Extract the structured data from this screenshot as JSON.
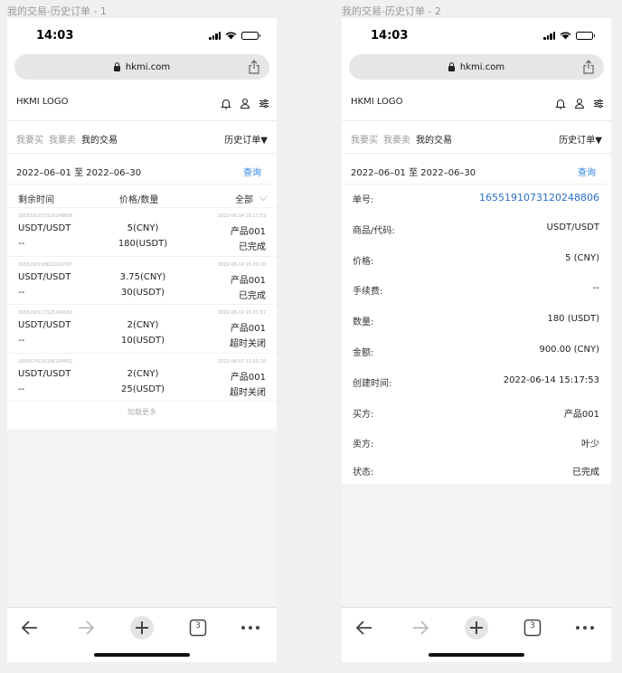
{
  "frames": [
    {
      "label": "我的交易-历史订单 - 1",
      "status": {
        "time": "14:03"
      },
      "browser": {
        "url": "hkmi.com",
        "tab_count": "3"
      },
      "header": {
        "logo": "HKMI LOGO"
      },
      "tabs": [
        "我要买",
        "我要卖",
        "我的交易"
      ],
      "filter": "历史订单▼",
      "date_range": "2022–06–01 至 2022–06–30",
      "query_label": "查询",
      "columns": {
        "remaining": "剩余时间",
        "price_qty": "价格/数量",
        "all": "全部"
      },
      "orders": [
        {
          "id": "1655191073120248806",
          "time": "2022-06-14 15:17:53",
          "pair": "USDT/USDT",
          "remaining": "--",
          "price": "5(CNY)",
          "qty": "180(USDT)",
          "product": "产品001",
          "status": "已完成"
        },
        {
          "id": "1655190190622241787",
          "time": "2022-06-14 15:03:10",
          "pair": "USDT/USDT",
          "remaining": "--",
          "price": "3.75(CNY)",
          "qty": "30(USDT)",
          "product": "产品001",
          "status": "已完成"
        },
        {
          "id": "1655190117125246562",
          "time": "2022-06-14 15:01:57",
          "pair": "USDT/USDT",
          "remaining": "--",
          "price": "2(CNY)",
          "qty": "10(USDT)",
          "product": "产品001",
          "status": "超时关闭"
        },
        {
          "id": "1654574116166244852",
          "time": "2022-06-07 11:55:16",
          "pair": "USDT/USDT",
          "remaining": "--",
          "price": "2(CNY)",
          "qty": "25(USDT)",
          "product": "产品001",
          "status": "超时关闭"
        }
      ],
      "load_more": "加载更多"
    },
    {
      "label": "我的交易-历史订单 - 2",
      "status": {
        "time": "14:03"
      },
      "browser": {
        "url": "hkmi.com",
        "tab_count": "3"
      },
      "header": {
        "logo": "HKMI LOGO"
      },
      "tabs": [
        "我要买",
        "我要卖",
        "我的交易"
      ],
      "filter": "历史订单▼",
      "date_range": "2022–06–01 至 2022–06–30",
      "query_label": "查询",
      "details": [
        {
          "key": "单号:",
          "value": "1655191073120248806"
        },
        {
          "key": "商品/代码:",
          "value": "USDT/USDT"
        },
        {
          "key": "价格:",
          "value": "5 (CNY)"
        },
        {
          "key": "手续费:",
          "value": "--"
        },
        {
          "key": "数量:",
          "value": "180 (USDT)"
        },
        {
          "key": "金额:",
          "value": "900.00 (CNY)"
        },
        {
          "key": "创建时间:",
          "value": "2022-06-14 15:17:53"
        },
        {
          "key": "买方:",
          "value": "产品001"
        },
        {
          "key": "卖方:",
          "value": "叶少"
        },
        {
          "key": "状态:",
          "value": "已完成"
        }
      ]
    }
  ],
  "colors": {
    "link": "#2c86e6",
    "order_link": "#2c6fc8",
    "muted": "#999999"
  }
}
